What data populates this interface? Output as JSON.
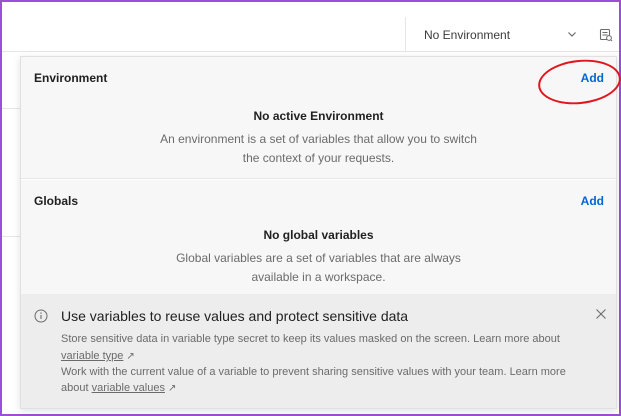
{
  "topbar": {
    "environment_select_value": "No Environment"
  },
  "environment_section": {
    "title": "Environment",
    "add_label": "Add",
    "empty_title": "No active Environment",
    "empty_description": "An environment is a set of variables that allow you to switch the context of your requests."
  },
  "globals_section": {
    "title": "Globals",
    "add_label": "Add",
    "empty_title": "No global variables",
    "empty_description": "Global variables are a set of variables that are always available in a workspace."
  },
  "banner": {
    "title": "Use variables to reuse values and protect sensitive data",
    "line1": "Store sensitive data in variable type secret to keep its values masked on the screen. Learn more about",
    "link1": "variable type",
    "line2": "Work with the current value of a variable to prevent sharing sensitive values with your team. Learn more",
    "line3_prefix": "about",
    "link2": "variable values"
  },
  "colors": {
    "accent": "#0265d2",
    "annotation": "#e0161d",
    "frame": "#9b4fd6"
  },
  "icons": {
    "select_chevron": "chevron-down-icon",
    "quicklook": "environment-quicklook-icon",
    "info": "info-icon",
    "close": "close-icon",
    "external": "external-link-icon"
  }
}
